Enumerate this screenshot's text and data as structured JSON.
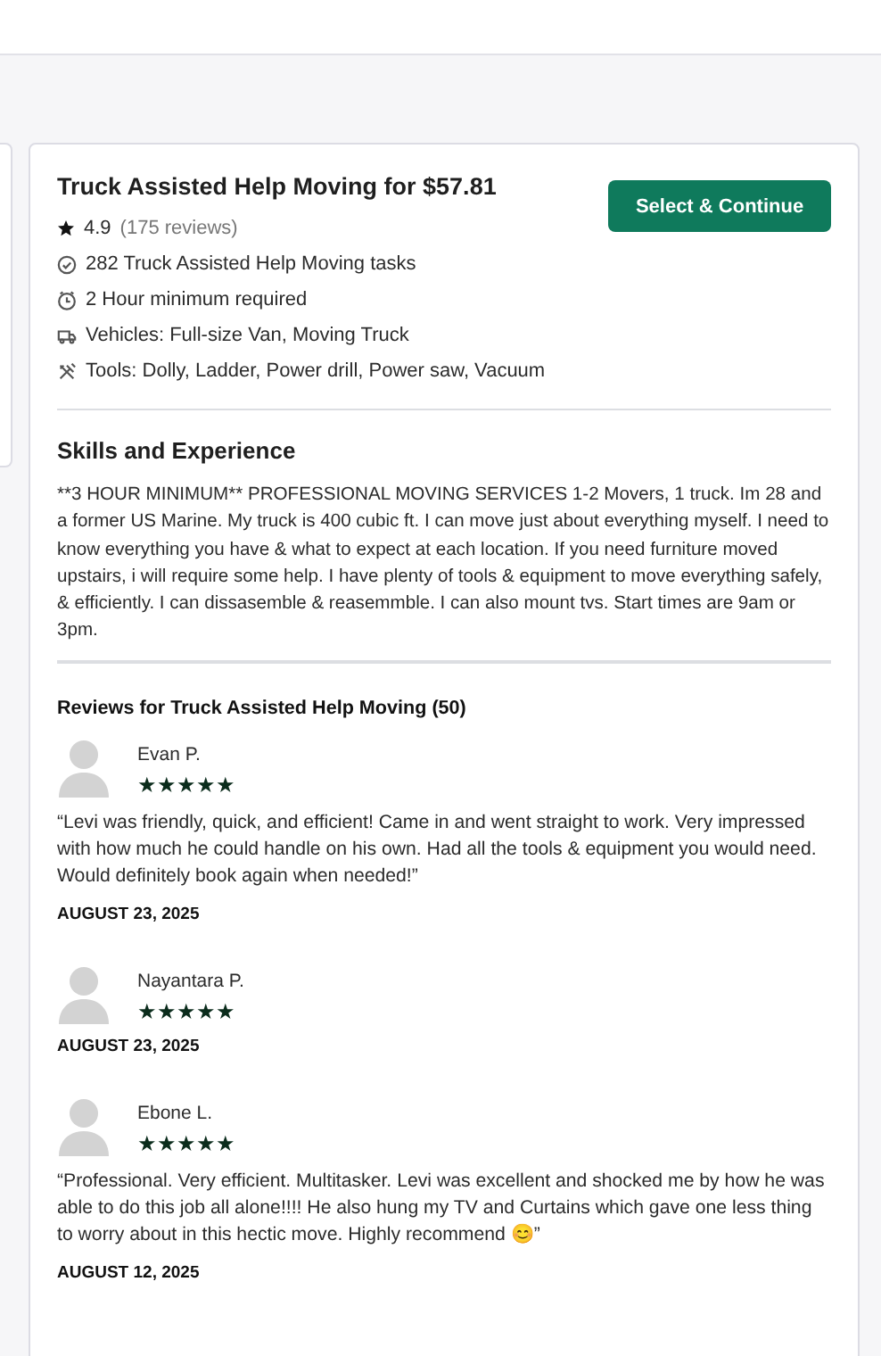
{
  "tasker": {
    "title": "Truck Assisted Help Moving for $57.81",
    "rating": "4.9",
    "reviews_count": "(175 reviews)",
    "button": "Select & Continue",
    "facts": [
      {
        "kind": "check",
        "text": "282 Truck Assisted Help Moving tasks"
      },
      {
        "kind": "clock",
        "text": "2 Hour minimum required"
      },
      {
        "kind": "vehicle",
        "text": "Vehicles: Full-size Van, Moving Truck"
      },
      {
        "kind": "tools",
        "text": "Tools: Dolly, Ladder, Power drill, Power saw, Vacuum"
      }
    ]
  },
  "skills": {
    "heading": "Skills and Experience",
    "text": "**3 HOUR MINIMUM** PROFESSIONAL MOVING SERVICES 1-2 Movers, 1 truck. Im 28 and a former US Marine. My truck is 400 cubic ft. I can move just about everything myself. I need to know everything you have & what to expect at each location. If you need furniture moved upstairs, i will require some help. I have plenty of tools & equipment to move everything safely, & efficiently. I can dissasemble & reasemmble. I can also mount tvs. Start times are 9am or 3pm."
  },
  "reviews": {
    "heading": "Reviews for Truck Assisted Help Moving (50)",
    "items": [
      {
        "name": "Evan P.",
        "stars": 5,
        "text": "“Levi was friendly, quick, and efficient! Came in and went straight to work. Very impressed with how much he could handle on his own. Had all the tools & equipment you would need. Would definitely book again when needed!”",
        "date": "AUGUST 23, 2025"
      },
      {
        "name": "Nayantara P.",
        "stars": 5,
        "date": "AUGUST 23, 2025"
      },
      {
        "name": "Ebone L.",
        "stars": 5,
        "text": "“Professional. Very efficient. Multitasker. Levi was excellent and shocked me by how he was able to do this job all alone!!!! He also hung my TV and Curtains which gave one less thing to worry about in this hectic move. Highly recommend 😊”",
        "date": "AUGUST 12, 2025"
      }
    ]
  }
}
